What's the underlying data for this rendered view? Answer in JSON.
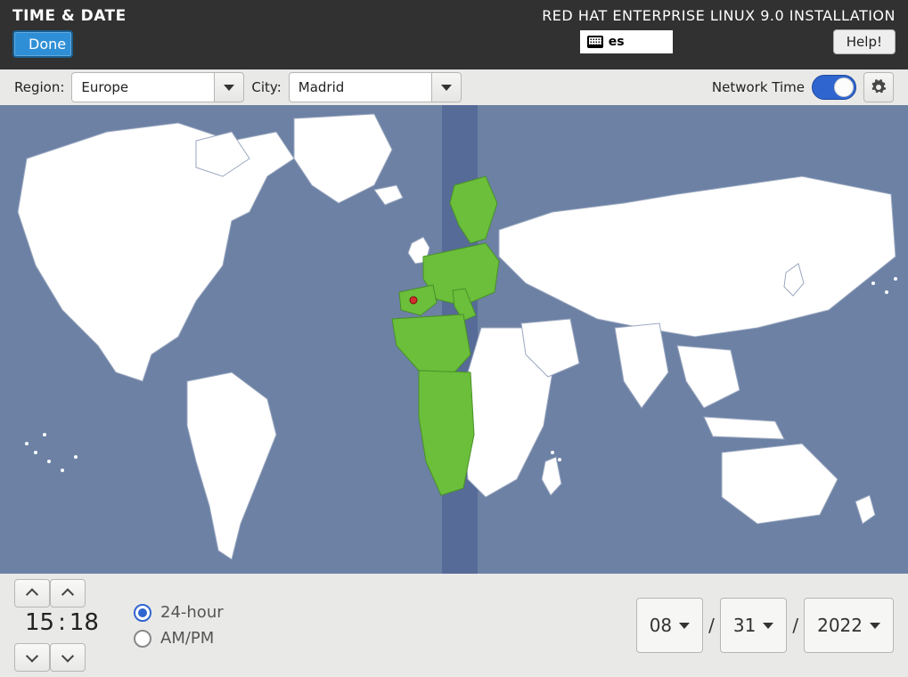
{
  "header": {
    "title": "TIME & DATE",
    "done_label": "Done",
    "product_label": "RED HAT ENTERPRISE LINUX 9.0 INSTALLATION",
    "keyboard_layout": "es",
    "help_label": "Help!"
  },
  "toolbar": {
    "region_label": "Region:",
    "region_value": "Europe",
    "city_label": "City:",
    "city_value": "Madrid",
    "network_time_label": "Network Time",
    "network_time_on": true
  },
  "time": {
    "hours": "15",
    "minutes": "18",
    "separator": ":"
  },
  "time_format": {
    "option_24h": "24-hour",
    "option_ampm": "AM/PM",
    "selected": "24-hour"
  },
  "date": {
    "month": "08",
    "day": "31",
    "year": "2022",
    "separator": "/"
  },
  "colors": {
    "accent_blue": "#2f65cf",
    "map_bg": "#6c81a4",
    "selected_green": "#6bbf3b",
    "button_blue": "#2f8fd6"
  }
}
